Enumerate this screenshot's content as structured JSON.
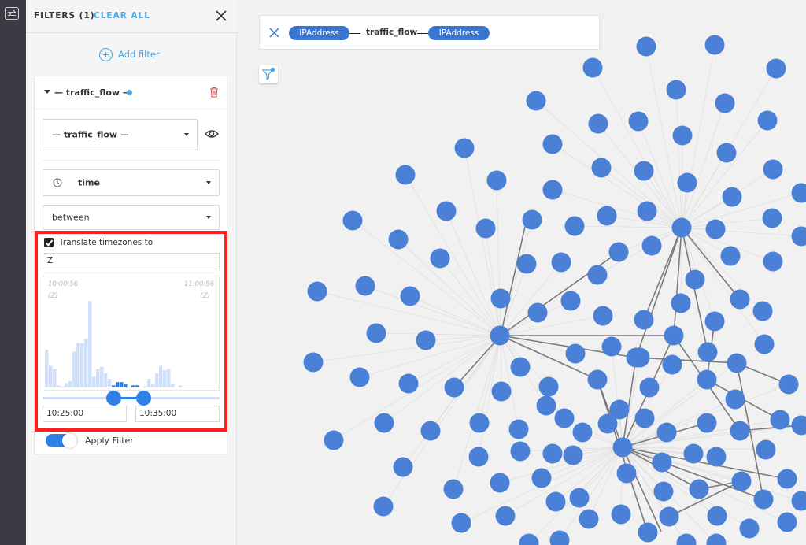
{
  "panel": {
    "title": "FILTERS (1)",
    "clear_all": "CLEAR ALL",
    "add_filter": "Add filter"
  },
  "filter": {
    "title": "— traffic_flow —",
    "type_select": "— traffic_flow —",
    "field_select": "time",
    "operator_select": "between",
    "translate_label": "Translate timezones to",
    "translate_checked": true,
    "timezone": "Z",
    "range_start_label": "10:00:56",
    "range_end_label": "11:00:56",
    "range_start_tz": "(Z)",
    "range_end_tz": "(Z)",
    "from": "10:25:00",
    "to": "10:35:00",
    "slider_from_fraction": 0.4,
    "slider_to_fraction": 0.57,
    "apply_label": "Apply Filter",
    "apply_on": true
  },
  "histogram": {
    "bars": [
      35,
      20,
      17,
      2,
      1,
      4,
      6,
      33,
      41,
      41,
      45,
      80,
      10,
      17,
      19,
      13,
      8,
      2,
      5,
      5,
      3,
      0,
      2,
      2,
      0,
      1,
      8,
      3,
      13,
      20,
      16,
      17,
      3,
      0,
      2,
      0,
      0,
      0,
      0,
      0,
      0,
      0
    ],
    "bars_b": [
      0,
      0,
      0,
      0,
      0,
      0,
      0,
      0,
      0,
      0,
      0,
      0,
      0,
      0,
      0,
      0,
      0,
      0,
      0,
      0,
      0,
      0,
      0,
      0,
      0,
      0,
      0,
      0,
      0,
      0,
      0,
      0,
      0,
      0,
      0,
      0,
      0,
      0,
      0,
      0,
      0,
      0
    ],
    "colors": {
      "light": "#cfe0f8",
      "selected": "#2e80e8"
    }
  },
  "query": {
    "source": "IPAddress",
    "edge": "traffic_flow",
    "target": "IPAddress"
  },
  "colors": {
    "node": "#4a80d6",
    "accent": "#4ba8e0",
    "highlight": "#ff1f1f"
  }
}
